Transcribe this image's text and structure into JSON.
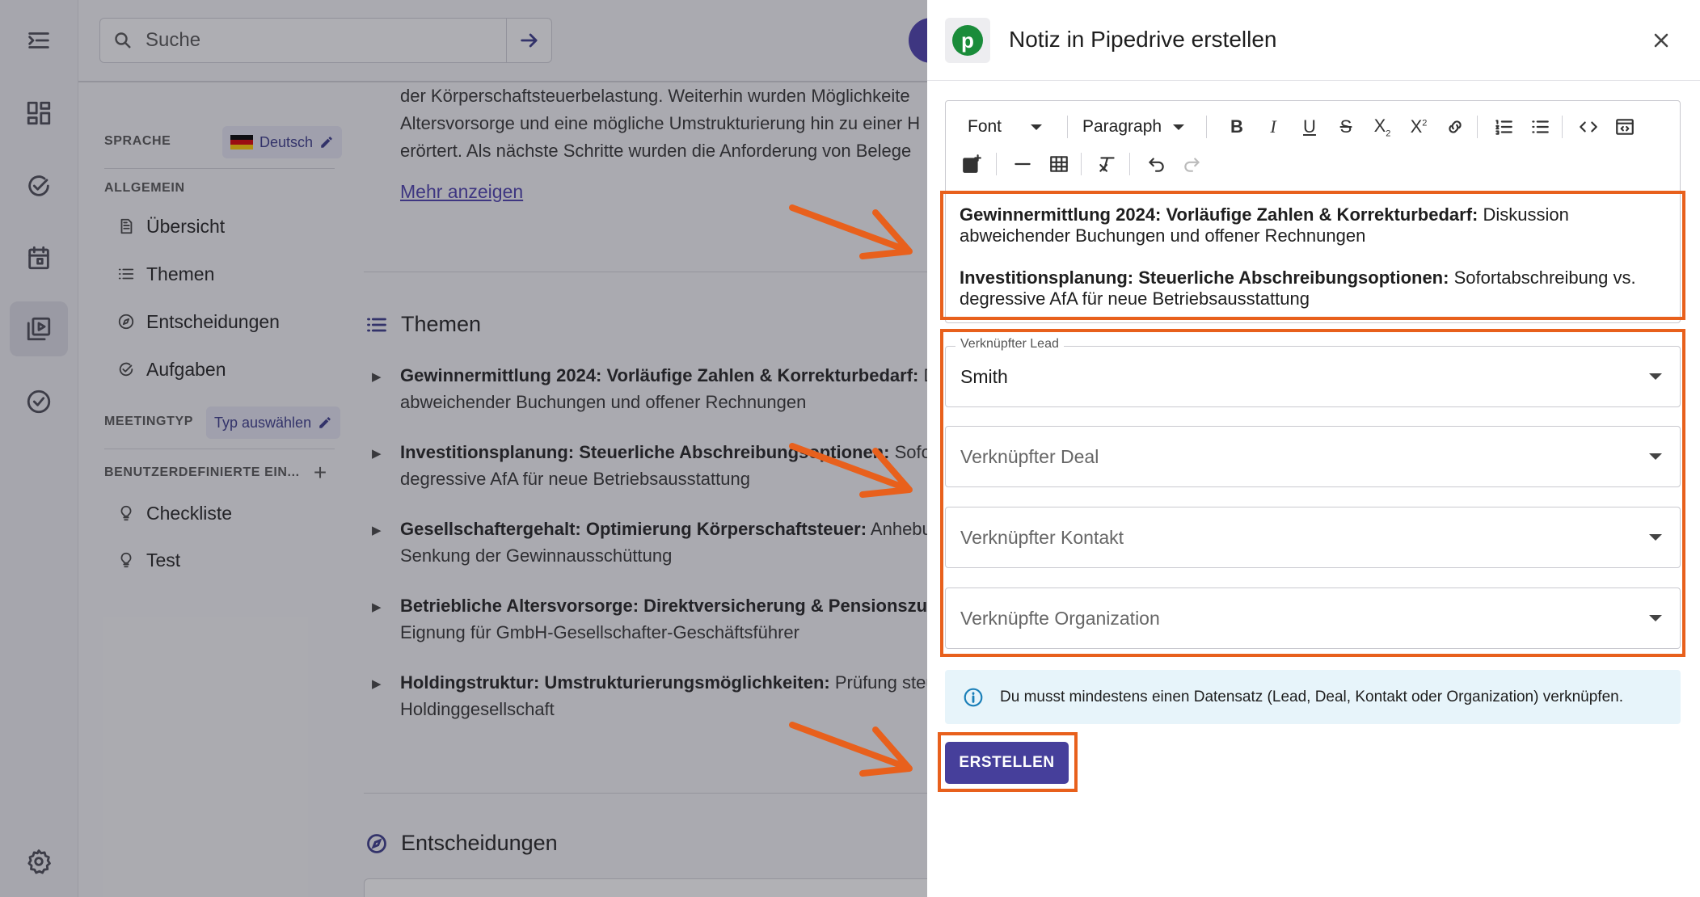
{
  "search": {
    "placeholder": "Suche"
  },
  "nav": {
    "language_heading": "SPRACHE",
    "language_value": "Deutsch",
    "general_heading": "ALLGEMEIN",
    "items": [
      "Übersicht",
      "Themen",
      "Entscheidungen",
      "Aufgaben"
    ],
    "meeting_type_heading": "MEETINGTYP",
    "meeting_type_value": "Typ auswählen",
    "custom_heading": "BENUTZERDEFINIERTE EIN...",
    "custom_items": [
      "Checkliste",
      "Test"
    ]
  },
  "main": {
    "summary_lines": [
      "der Körperschaftsteuerbelastung. Weiterhin wurden Möglichkeite",
      "Altersvorsorge und eine mögliche Umstrukturierung hin zu einer H",
      "erörtert. Als nächste Schritte wurden die Anforderung von Belege"
    ],
    "more_link": "Mehr anzeigen",
    "topics_title": "Themen",
    "topics": [
      {
        "bold": "Gewinnermittlung 2024: Vorläufige Zahlen & Korrekturbedarf:",
        "rest": " D",
        "line2": "abweichender Buchungen und offener Rechnungen"
      },
      {
        "bold": "Investitionsplanung: Steuerliche Abschreibungsoptionen:",
        "rest": " Sofort",
        "line2": "degressive AfA für neue Betriebsausstattung"
      },
      {
        "bold": "Gesellschaftergehalt: Optimierung Körperschaftsteuer:",
        "rest": " Anhebun",
        "line2": "Senkung der Gewinnausschüttung"
      },
      {
        "bold": "Betriebliche Altersvorsorge: Direktversicherung & Pensionszusa",
        "rest": "",
        "line2": "Eignung für GmbH-Gesellschafter-Geschäftsführer"
      },
      {
        "bold": "Holdingstruktur: Umstrukturierungsmöglichkeiten:",
        "rest": " Prüfung steu",
        "line2": "Holdinggesellschaft"
      }
    ],
    "decisions_title": "Entscheidungen"
  },
  "drawer": {
    "title": "Notiz in Pipedrive erstellen",
    "logo_letter": "p",
    "toolbar": {
      "font": "Font",
      "paragraph": "Paragraph"
    },
    "content": [
      {
        "bold": "Gewinnermittlung 2024: Vorläufige Zahlen & Korrekturbedarf:",
        "rest": " Diskussion abweichender Buchungen und offener Rechnungen"
      },
      {
        "bold": "Investitionsplanung: Steuerliche Abschreibungsoptionen:",
        "rest": " Sofortabschreibung vs. degressive AfA für neue Betriebsausstattung"
      }
    ],
    "fields": {
      "lead_label": "Verknüpfter Lead",
      "lead_value": "Smith",
      "deal_placeholder": "Verknüpfter Deal",
      "contact_placeholder": "Verknüpfter Kontakt",
      "org_placeholder": "Verknüpfte Organization"
    },
    "info_text": "Du musst mindestens einen Datensatz (Lead, Deal, Kontakt oder Organization) verknüpfen.",
    "create_label": "ERSTELLEN"
  },
  "colors": {
    "accent": "#463f9b",
    "highlight": "#e8601c",
    "pipedrive_green": "#1a8c3a",
    "info_bg": "#e7f4fa"
  }
}
